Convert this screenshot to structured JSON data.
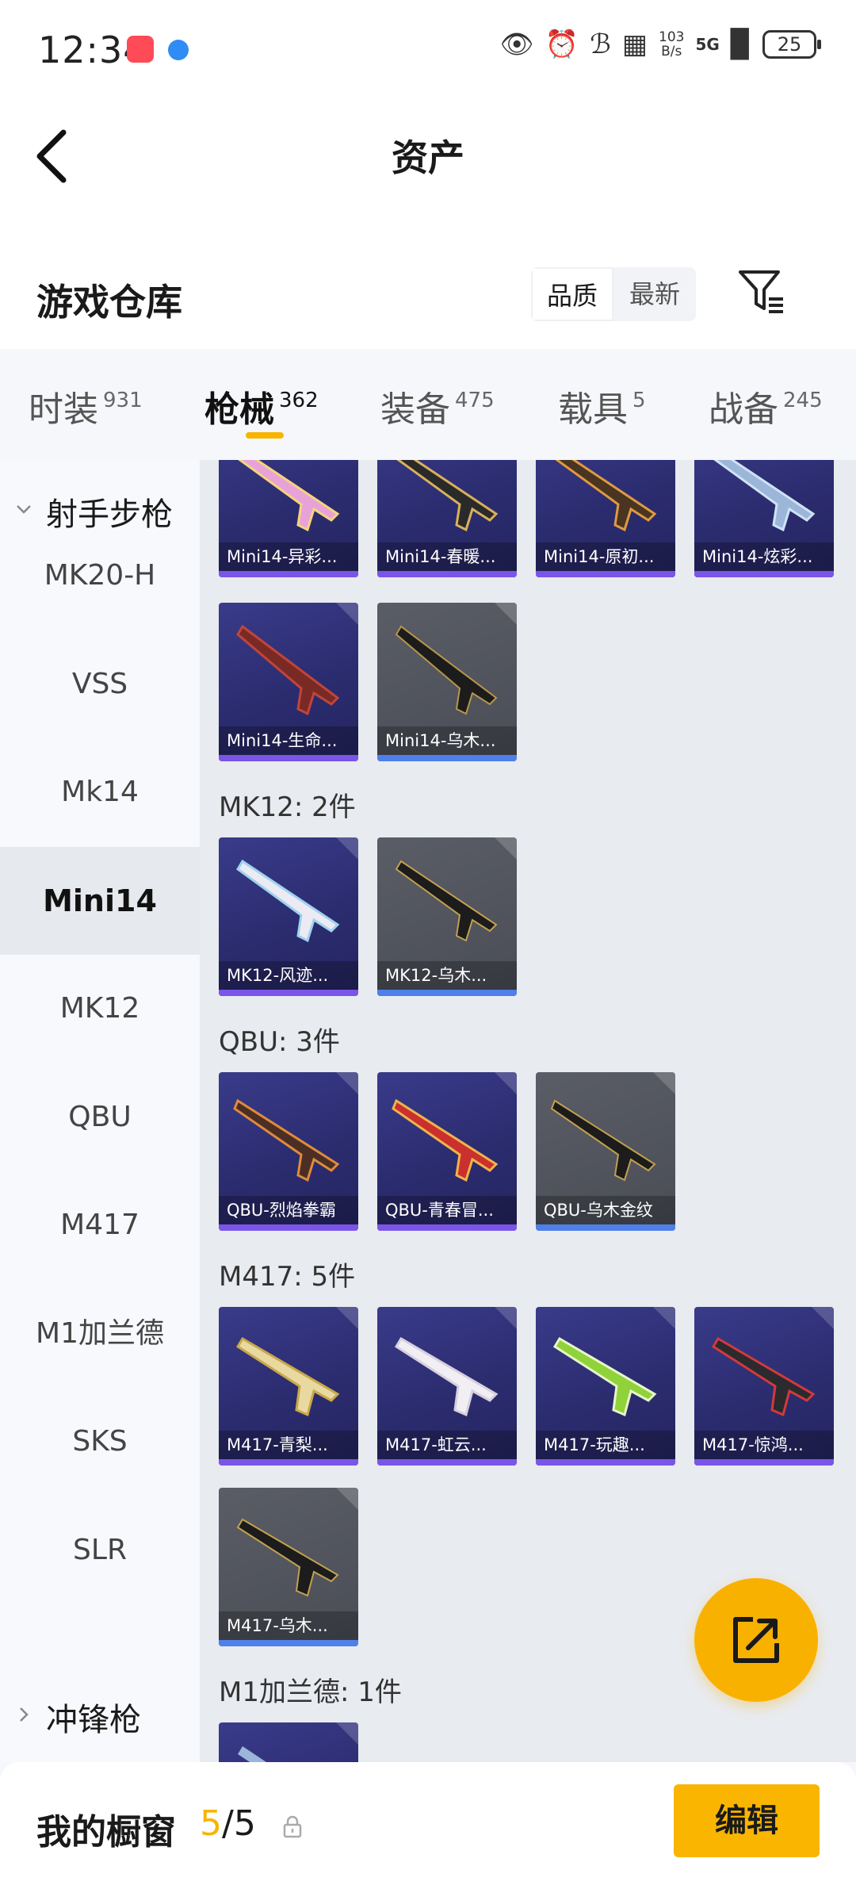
{
  "status_bar": {
    "time": "12:34",
    "network_speed_top": "103",
    "network_speed_bottom": "B/s",
    "network_type": "5G",
    "battery": "25"
  },
  "header": {
    "title": "资产"
  },
  "warehouse": {
    "title": "游戏仓库",
    "sort_options": [
      "品质",
      "最新"
    ],
    "sort_selected": "品质"
  },
  "tabs": [
    {
      "label": "时装",
      "count": "931"
    },
    {
      "label": "枪械",
      "count": "362"
    },
    {
      "label": "装备",
      "count": "475"
    },
    {
      "label": "载具",
      "count": "5"
    },
    {
      "label": "战备",
      "count": "245"
    }
  ],
  "active_tab": "枪械",
  "sidebar": {
    "group_open": "射手步枪",
    "items": [
      "MK20-H",
      "VSS",
      "Mk14",
      "Mini14",
      "MK12",
      "QBU",
      "M417",
      "M1加兰德",
      "SKS",
      "SLR"
    ],
    "active_item": "Mini14",
    "group_closed": "冲锋枪"
  },
  "groups": [
    {
      "label": "",
      "items": [
        {
          "name": "Mini14-异彩...",
          "rarity": "purple",
          "icon": "rifle-pink-icon"
        },
        {
          "name": "Mini14-春暖...",
          "rarity": "purple",
          "icon": "rifle-gold-icon"
        },
        {
          "name": "Mini14-原初...",
          "rarity": "purple",
          "icon": "rifle-orange-icon"
        },
        {
          "name": "Mini14-炫彩...",
          "rarity": "purple",
          "icon": "rifle-blue-icon"
        },
        {
          "name": "Mini14-生命...",
          "rarity": "purple",
          "icon": "rifle-red-icon"
        },
        {
          "name": "Mini14-乌木...",
          "rarity": "grey",
          "icon": "rifle-black-icon"
        }
      ]
    },
    {
      "label": "MK12: 2件",
      "items": [
        {
          "name": "MK12-风迹...",
          "rarity": "purple",
          "icon": "rifle-white-icon"
        },
        {
          "name": "MK12-乌木...",
          "rarity": "grey",
          "icon": "rifle-black-icon"
        }
      ]
    },
    {
      "label": "QBU: 3件",
      "items": [
        {
          "name": "QBU-烈焰拳霸",
          "rarity": "purple",
          "icon": "rifle-orange-icon"
        },
        {
          "name": "QBU-青春冒...",
          "rarity": "purple",
          "icon": "rifle-red-icon"
        },
        {
          "name": "QBU-乌木金纹",
          "rarity": "grey",
          "icon": "rifle-black-icon"
        }
      ]
    },
    {
      "label": "M417: 5件",
      "items": [
        {
          "name": "M417-青梨...",
          "rarity": "purple",
          "icon": "rifle-gold-icon"
        },
        {
          "name": "M417-虹云...",
          "rarity": "purple",
          "icon": "rifle-white-icon"
        },
        {
          "name": "M417-玩趣...",
          "rarity": "purple",
          "icon": "rifle-green-icon"
        },
        {
          "name": "M417-惊鸿...",
          "rarity": "purple",
          "icon": "rifle-red-icon"
        },
        {
          "name": "M417-乌木...",
          "rarity": "grey",
          "icon": "rifle-black-icon"
        }
      ]
    },
    {
      "label": "M1加兰德: 1件",
      "items": [
        {
          "name": "",
          "rarity": "purple",
          "icon": "rifle-blue-icon"
        }
      ]
    }
  ],
  "bottom_bar": {
    "title": "我的橱窗",
    "count_current": "5",
    "count_total": "/5",
    "edit_label": "编辑"
  },
  "colors": {
    "accent": "#f9b500",
    "rarity_purple": "#7a55e8",
    "rarity_grey": "#4f7fe8"
  }
}
